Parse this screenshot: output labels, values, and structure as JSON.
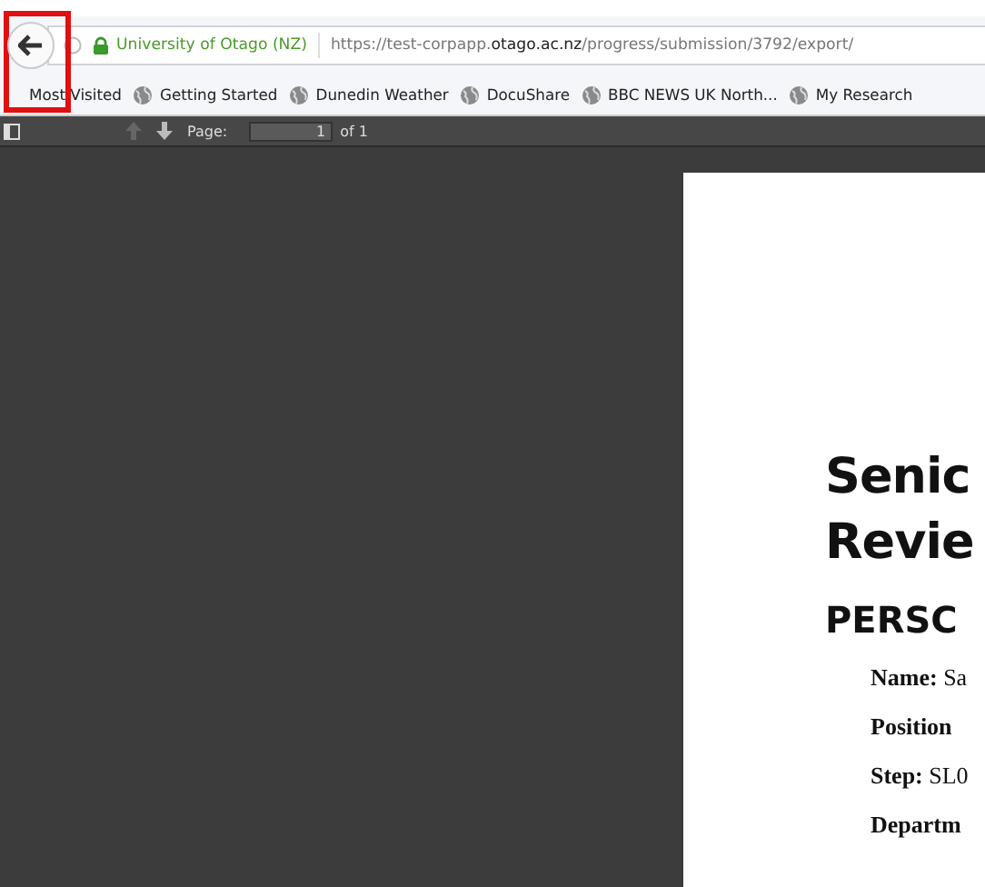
{
  "address_bar": {
    "site_identity": "University of Otago (NZ)",
    "url": "https://test-corpapp.**otago.ac.nz**/progress/submission/3792/export/"
  },
  "bookmarks": [
    {
      "label": "Most Visited",
      "kind": "folder"
    },
    {
      "label": "Getting Started",
      "kind": "globe"
    },
    {
      "label": "Dunedin Weather",
      "kind": "globe"
    },
    {
      "label": "DocuShare",
      "kind": "globe"
    },
    {
      "label": "BBC NEWS  UK  North...",
      "kind": "globe"
    },
    {
      "label": "My Research",
      "kind": "globe"
    }
  ],
  "pdf_toolbar": {
    "page_label": "Page:",
    "page_value": "1",
    "page_count": "of 1"
  },
  "document": {
    "title_lines": [
      "Senic",
      "Revie"
    ],
    "section_heading": "PERSC",
    "fields": [
      "**Name:** Sa",
      "**Position**",
      "**Step:** SL0",
      "**Departm**"
    ]
  }
}
